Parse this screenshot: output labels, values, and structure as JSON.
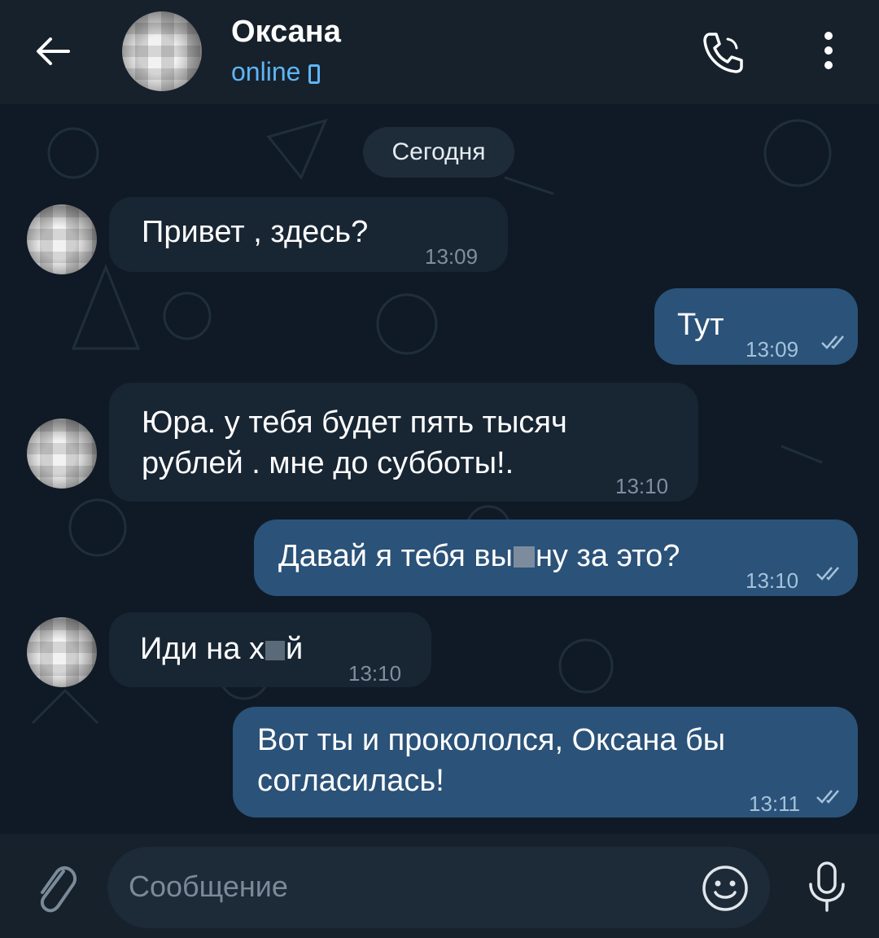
{
  "header": {
    "contact_name": "Оксана",
    "status": "online",
    "icons": {
      "back": "arrow-left-icon",
      "call": "phone-icon",
      "more": "more-vertical-icon",
      "device": "mobile-device-icon"
    }
  },
  "chat": {
    "date_label": "Сегодня",
    "messages": [
      {
        "direction": "in",
        "text": "Привет , здесь?",
        "time": "13:09"
      },
      {
        "direction": "out",
        "text": "Тут",
        "time": "13:09",
        "read": true
      },
      {
        "direction": "in",
        "lines": [
          "Юра. у тебя будет пять тысяч",
          "рублей . мне до субботы!."
        ],
        "time": "13:10"
      },
      {
        "direction": "out",
        "text_before": "Давай я тебя вы",
        "text_after": "ну за это?",
        "time": "13:10",
        "read": true
      },
      {
        "direction": "in",
        "text_before": "Иди на х",
        "text_after": "й",
        "time": "13:10"
      },
      {
        "direction": "out",
        "lines": [
          "Вот ты и прокололся, Оксана бы",
          "согласилась!"
        ],
        "time": "13:11",
        "read": true
      }
    ]
  },
  "input": {
    "placeholder": "Сообщение",
    "icons": {
      "attach": "paperclip-icon",
      "emoji": "emoji-icon",
      "mic": "microphone-icon"
    }
  },
  "colors": {
    "header_bg": "#17212b",
    "chat_bg": "#0f1a26",
    "incoming_bubble": "#182533",
    "outgoing_bubble": "#2b5278",
    "accent": "#5eb5f7"
  }
}
